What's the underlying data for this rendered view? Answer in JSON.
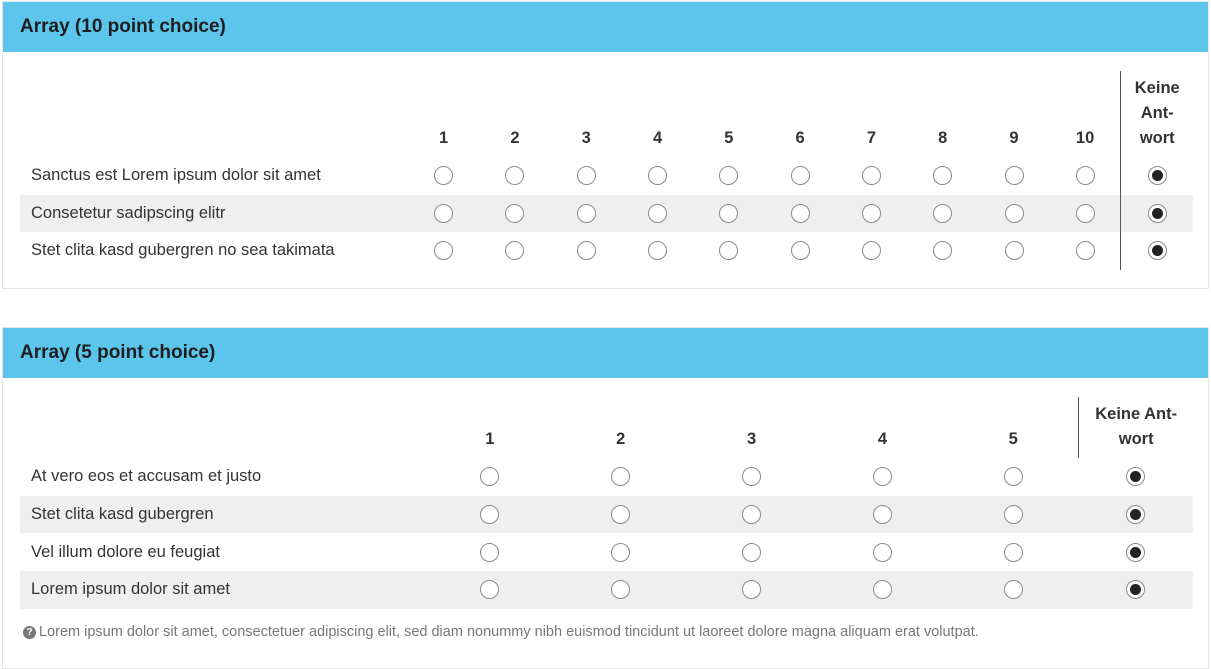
{
  "q1": {
    "title": "Array (10 point choice)",
    "columns": [
      "1",
      "2",
      "3",
      "4",
      "5",
      "6",
      "7",
      "8",
      "9",
      "10"
    ],
    "no_answer": [
      "Keine",
      "Ant-",
      "wort"
    ],
    "rows": [
      {
        "label": "Sanctus est Lorem ipsum dolor sit amet",
        "selected": "no_answer"
      },
      {
        "label": "Consetetur sadipscing elitr",
        "selected": "no_answer"
      },
      {
        "label": "Stet clita kasd gubergren no sea takimata",
        "selected": "no_answer"
      }
    ]
  },
  "q2": {
    "title": "Array (5 point choice)",
    "columns": [
      "1",
      "2",
      "3",
      "4",
      "5"
    ],
    "no_answer": [
      "Keine Ant-",
      "wort"
    ],
    "rows": [
      {
        "label": "At vero eos et accusam et justo",
        "selected": "no_answer"
      },
      {
        "label": "Stet clita kasd gubergren",
        "selected": "no_answer"
      },
      {
        "label": "Vel illum dolore eu feugiat",
        "selected": "no_answer"
      },
      {
        "label": "Lorem ipsum dolor sit amet",
        "selected": "no_answer"
      }
    ],
    "help_icon": "question-circle-icon",
    "help_text": "Lorem ipsum dolor sit amet, consectetuer adipiscing elit, sed diam nonummy nibh euismod tincidunt ut laoreet dolore magna aliquam erat volutpat."
  },
  "colors": {
    "header_bg": "#5bc5ec",
    "alt_row": "#efefef"
  }
}
